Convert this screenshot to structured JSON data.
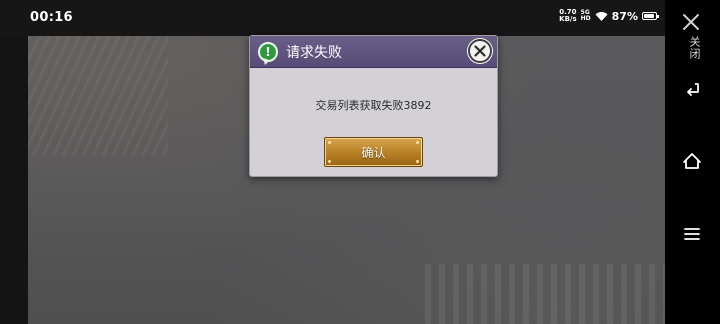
{
  "status_bar": {
    "time": "00:16",
    "net_speed_value": "0.70",
    "net_speed_unit": "KB/s",
    "network_top": "5G",
    "network_bottom": "HD",
    "battery_percent": "87%",
    "battery_level": 0.87
  },
  "dialog": {
    "title": "请求失败",
    "message": "交易列表获取失败3892",
    "confirm_label": "确认",
    "header_color": "#574c77",
    "button_color": "#b77f23",
    "icon": "alert-icon"
  },
  "nav_bar": {
    "close_label": "关闭",
    "icons": [
      "close-icon",
      "back-icon",
      "home-icon",
      "menu-icon"
    ]
  }
}
